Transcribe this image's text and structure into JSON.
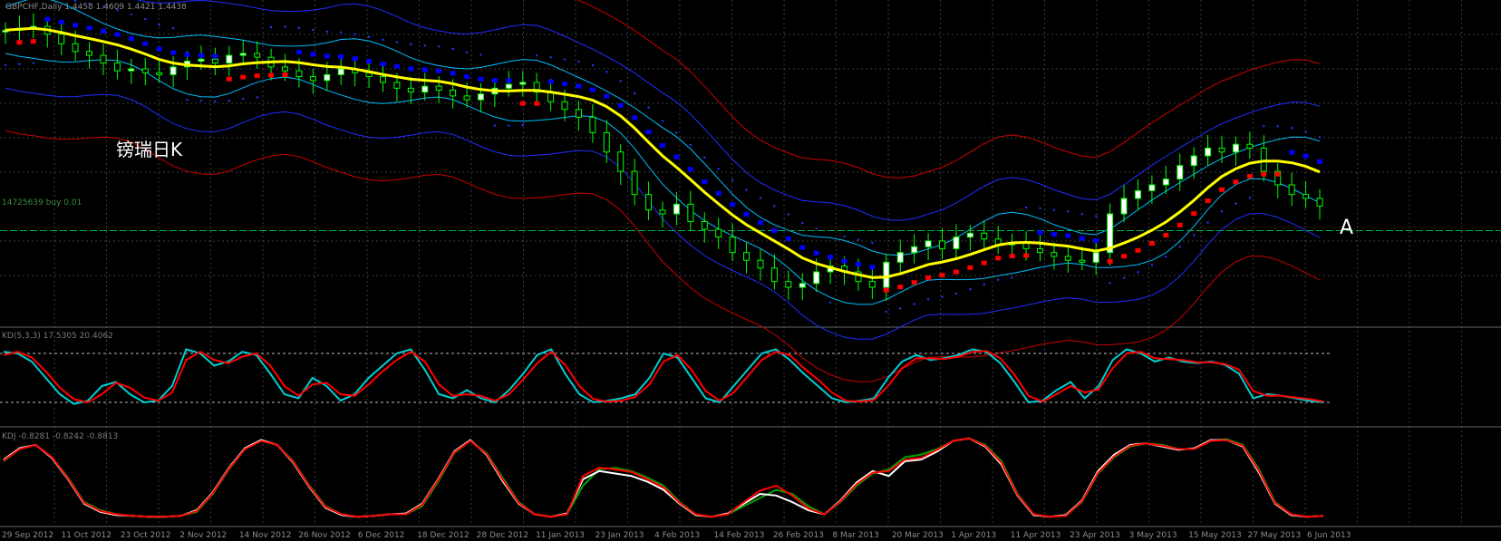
{
  "chart_data": [
    {
      "type": "line",
      "symbol_header": "GBPCHF,Daily  1.4458 1.4609 1.4421 1.4438",
      "annotation_text": "镑瑞日K",
      "marker_label": "A",
      "hline_label": "14725639 buy 0.01",
      "colors": {
        "background": "#000000",
        "grid": "#3b3b3b",
        "bull_candle": "#00ff00",
        "bull_body": "#ffffff",
        "ma": "#ffff00",
        "band_inner": "#00bfff",
        "band_mid": "#1f2fff",
        "band_outer": "#cc0000",
        "trend_red": "#ff0000",
        "trend_blue": "#0000ff",
        "dots": "#1e3cff",
        "hline": "#00b050"
      },
      "x_ticks": [
        "29 Sep 2012",
        "11 Oct 2012",
        "23 Oct 2012",
        "2 Nov 2012",
        "14 Nov 2012",
        "26 Nov 2012",
        "6 Dec 2012",
        "18 Dec 2012",
        "28 Dec 2012",
        "11 Jan 2013",
        "23 Jan 2013",
        "4 Feb 2013",
        "14 Feb 2013",
        "26 Feb 2013",
        "8 Mar 2013",
        "20 Mar 2013",
        "1 Apr 2013",
        "11 Apr 2013",
        "23 Apr 2013",
        "3 May 2013",
        "15 May 2013",
        "27 May 2013",
        "6 Jun 2013"
      ],
      "close_prices": [
        1.535,
        1.536,
        1.537,
        1.533,
        1.528,
        1.524,
        1.522,
        1.518,
        1.514,
        1.515,
        1.513,
        1.512,
        1.516,
        1.519,
        1.52,
        1.518,
        1.522,
        1.523,
        1.521,
        1.516,
        1.514,
        1.511,
        1.509,
        1.512,
        1.515,
        1.513,
        1.511,
        1.508,
        1.505,
        1.503,
        1.506,
        1.504,
        1.501,
        1.499,
        1.502,
        1.505,
        1.507,
        1.508,
        1.503,
        1.498,
        1.494,
        1.49,
        1.482,
        1.472,
        1.462,
        1.45,
        1.442,
        1.44,
        1.445,
        1.436,
        1.432,
        1.428,
        1.42,
        1.416,
        1.412,
        1.405,
        1.402,
        1.404,
        1.41,
        1.413,
        1.41,
        1.405,
        1.402,
        1.415,
        1.42,
        1.423,
        1.426,
        1.422,
        1.428,
        1.43,
        1.427,
        1.424,
        1.425,
        1.422,
        1.42,
        1.418,
        1.416,
        1.415,
        1.42,
        1.44,
        1.448,
        1.452,
        1.455,
        1.458,
        1.465,
        1.47,
        1.474,
        1.472,
        1.476,
        1.474,
        1.462,
        1.455,
        1.45,
        1.448,
        1.444
      ]
    },
    {
      "type": "line",
      "header": "KD(5,3,3) 17.5305 20.4062",
      "ylim": [
        0,
        100
      ],
      "levels": [
        80,
        20
      ],
      "series": [
        {
          "color": "#00ced1",
          "values": [
            82,
            80,
            70,
            50,
            30,
            18,
            22,
            40,
            45,
            30,
            20,
            22,
            40,
            85,
            80,
            65,
            70,
            82,
            78,
            55,
            30,
            25,
            50,
            40,
            22,
            30,
            50,
            65,
            80,
            85,
            60,
            30,
            25,
            35,
            25,
            20,
            35,
            55,
            78,
            85,
            55,
            30,
            20,
            22,
            25,
            30,
            50,
            80,
            75,
            50,
            25,
            20,
            40,
            60,
            80,
            85,
            72,
            55,
            40,
            25,
            20,
            22,
            25,
            50,
            70,
            78,
            72,
            74,
            78,
            85,
            82,
            68,
            45,
            20,
            22,
            35,
            45,
            25,
            40,
            72,
            85,
            80,
            70,
            75,
            70,
            68,
            70,
            66,
            55,
            25,
            30,
            28,
            25,
            22,
            20
          ]
        },
        {
          "color": "#ff0000",
          "values": [
            78,
            82,
            75,
            58,
            38,
            24,
            20,
            30,
            44,
            38,
            26,
            22,
            32,
            72,
            82,
            72,
            68,
            76,
            80,
            65,
            40,
            28,
            42,
            44,
            30,
            28,
            42,
            58,
            72,
            82,
            70,
            42,
            28,
            30,
            28,
            22,
            30,
            48,
            68,
            82,
            66,
            40,
            24,
            21,
            22,
            27,
            42,
            70,
            78,
            60,
            34,
            22,
            32,
            52,
            72,
            82,
            78,
            62,
            48,
            32,
            22,
            21,
            23,
            40,
            62,
            74,
            74,
            73,
            76,
            82,
            83,
            74,
            54,
            28,
            21,
            30,
            40,
            32,
            36,
            62,
            80,
            82,
            74,
            73,
            72,
            69,
            69,
            67,
            60,
            34,
            28,
            28,
            26,
            24,
            21
          ]
        }
      ]
    },
    {
      "type": "line",
      "header": "KDJ -0.8281 -0.8242 -0.8813",
      "series": [
        {
          "color": "#00a000",
          "values": [
            0.7,
            0.85,
            0.9,
            0.75,
            0.5,
            0.2,
            0.1,
            0.05,
            0.03,
            0.02,
            0.02,
            0.03,
            0.08,
            0.3,
            0.6,
            0.85,
            0.95,
            0.9,
            0.7,
            0.4,
            0.15,
            0.05,
            0.02,
            0.03,
            0.05,
            0.05,
            0.15,
            0.45,
            0.8,
            0.95,
            0.8,
            0.5,
            0.2,
            0.05,
            0.02,
            0.05,
            0.4,
            0.6,
            0.62,
            0.58,
            0.5,
            0.4,
            0.2,
            0.05,
            0.02,
            0.05,
            0.15,
            0.25,
            0.35,
            0.3,
            0.15,
            0.05,
            0.2,
            0.4,
            0.55,
            0.6,
            0.75,
            0.78,
            0.85,
            0.95,
            0.98,
            0.9,
            0.7,
            0.3,
            0.05,
            0.02,
            0.03,
            0.2,
            0.55,
            0.75,
            0.88,
            0.92,
            0.9,
            0.85,
            0.85,
            0.95,
            0.97,
            0.9,
            0.6,
            0.2,
            0.05,
            0.02,
            0.03
          ]
        },
        {
          "color": "#ffffff",
          "values": [
            0.72,
            0.86,
            0.9,
            0.74,
            0.48,
            0.18,
            0.08,
            0.04,
            0.03,
            0.02,
            0.02,
            0.03,
            0.1,
            0.32,
            0.62,
            0.86,
            0.96,
            0.9,
            0.68,
            0.38,
            0.13,
            0.04,
            0.02,
            0.03,
            0.05,
            0.06,
            0.18,
            0.48,
            0.82,
            0.96,
            0.78,
            0.46,
            0.18,
            0.05,
            0.02,
            0.06,
            0.48,
            0.58,
            0.55,
            0.52,
            0.45,
            0.35,
            0.18,
            0.04,
            0.02,
            0.06,
            0.18,
            0.3,
            0.28,
            0.2,
            0.1,
            0.05,
            0.22,
            0.44,
            0.58,
            0.52,
            0.7,
            0.72,
            0.82,
            0.95,
            0.98,
            0.88,
            0.66,
            0.28,
            0.04,
            0.02,
            0.04,
            0.22,
            0.58,
            0.78,
            0.9,
            0.92,
            0.88,
            0.84,
            0.86,
            0.96,
            0.96,
            0.88,
            0.56,
            0.18,
            0.04,
            0.02,
            0.03
          ]
        },
        {
          "color": "#ff0000",
          "values": [
            0.71,
            0.85,
            0.9,
            0.75,
            0.49,
            0.19,
            0.09,
            0.05,
            0.03,
            0.02,
            0.02,
            0.03,
            0.09,
            0.31,
            0.61,
            0.85,
            0.95,
            0.9,
            0.69,
            0.39,
            0.14,
            0.05,
            0.02,
            0.03,
            0.05,
            0.05,
            0.17,
            0.47,
            0.81,
            0.95,
            0.79,
            0.48,
            0.19,
            0.05,
            0.02,
            0.05,
            0.52,
            0.62,
            0.6,
            0.57,
            0.48,
            0.38,
            0.19,
            0.05,
            0.02,
            0.05,
            0.2,
            0.34,
            0.4,
            0.28,
            0.12,
            0.05,
            0.21,
            0.42,
            0.56,
            0.58,
            0.72,
            0.74,
            0.84,
            0.95,
            0.98,
            0.89,
            0.68,
            0.29,
            0.05,
            0.02,
            0.03,
            0.21,
            0.56,
            0.76,
            0.89,
            0.92,
            0.89,
            0.85,
            0.85,
            0.95,
            0.96,
            0.89,
            0.58,
            0.19,
            0.05,
            0.02,
            0.03
          ]
        }
      ]
    }
  ]
}
